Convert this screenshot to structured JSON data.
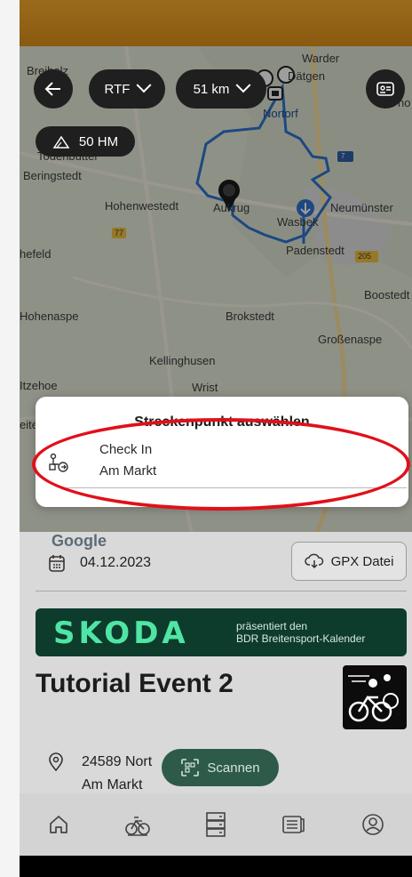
{
  "map": {
    "back_icon": "arrow-left-icon",
    "filter_label": "RTF",
    "distance_label": "51 km",
    "elevation_label": "50 HM",
    "profile_icon": "id-card-icon",
    "google_label": "Google",
    "towns": [
      "Warder",
      "Breiholz",
      "Dätgen",
      "Nortorf",
      "Todenbüttel",
      "Beringstedt",
      "Hohenwestedt",
      "Aukrug",
      "Wasbek",
      "Neumünster",
      "77",
      "Padenstedt",
      "205",
      "hefeld",
      "Boostedt",
      "Hohenaspe",
      "Brokstedt",
      "Großenaspe",
      "Kellinghusen",
      "Itzehoe",
      "Wrist",
      "7",
      "eite",
      "no"
    ]
  },
  "modal": {
    "title": "Streckenpunkt auswählen",
    "item_icon": "route-point-icon",
    "item_line1": "Check In",
    "item_line2": "Am Markt"
  },
  "event": {
    "date": "04.12.2023",
    "gpx_label": "GPX Datei",
    "banner_brand": "SKODA",
    "banner_sub1": "präsentiert den",
    "banner_sub2": "BDR Breitensport-Kalender",
    "title": "Tutorial Event 2",
    "address_line1": "24589 Nort",
    "address_line2": "Am Markt",
    "scan_label": "Scannen"
  },
  "nav": [
    "home-icon",
    "bike-icon",
    "list-icon",
    "news-icon",
    "profile-icon"
  ],
  "colors": {
    "highlight": "#e0101a",
    "banner_bg": "#0d3b2c",
    "brand_green": "#4fe5a5",
    "route": "#2f74d0"
  }
}
